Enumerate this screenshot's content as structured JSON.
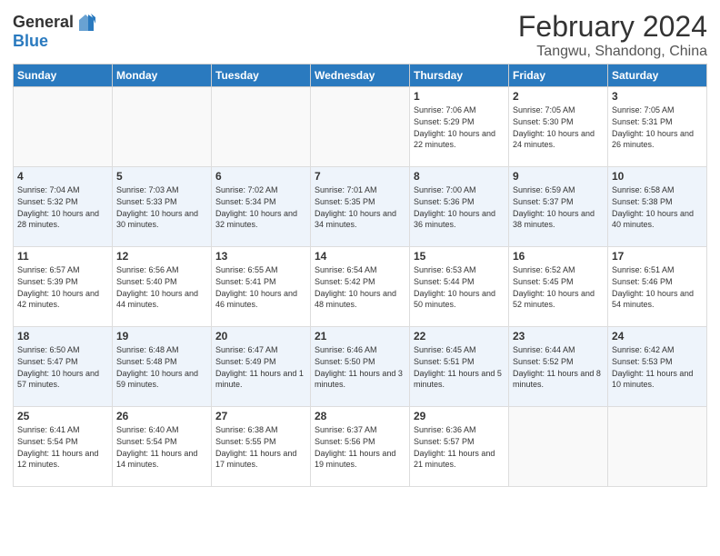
{
  "header": {
    "logo_general": "General",
    "logo_blue": "Blue",
    "month_title": "February 2024",
    "location": "Tangwu, Shandong, China"
  },
  "days_of_week": [
    "Sunday",
    "Monday",
    "Tuesday",
    "Wednesday",
    "Thursday",
    "Friday",
    "Saturday"
  ],
  "weeks": [
    [
      {
        "day": "",
        "info": ""
      },
      {
        "day": "",
        "info": ""
      },
      {
        "day": "",
        "info": ""
      },
      {
        "day": "",
        "info": ""
      },
      {
        "day": "1",
        "info": "Sunrise: 7:06 AM\nSunset: 5:29 PM\nDaylight: 10 hours and 22 minutes."
      },
      {
        "day": "2",
        "info": "Sunrise: 7:05 AM\nSunset: 5:30 PM\nDaylight: 10 hours and 24 minutes."
      },
      {
        "day": "3",
        "info": "Sunrise: 7:05 AM\nSunset: 5:31 PM\nDaylight: 10 hours and 26 minutes."
      }
    ],
    [
      {
        "day": "4",
        "info": "Sunrise: 7:04 AM\nSunset: 5:32 PM\nDaylight: 10 hours and 28 minutes."
      },
      {
        "day": "5",
        "info": "Sunrise: 7:03 AM\nSunset: 5:33 PM\nDaylight: 10 hours and 30 minutes."
      },
      {
        "day": "6",
        "info": "Sunrise: 7:02 AM\nSunset: 5:34 PM\nDaylight: 10 hours and 32 minutes."
      },
      {
        "day": "7",
        "info": "Sunrise: 7:01 AM\nSunset: 5:35 PM\nDaylight: 10 hours and 34 minutes."
      },
      {
        "day": "8",
        "info": "Sunrise: 7:00 AM\nSunset: 5:36 PM\nDaylight: 10 hours and 36 minutes."
      },
      {
        "day": "9",
        "info": "Sunrise: 6:59 AM\nSunset: 5:37 PM\nDaylight: 10 hours and 38 minutes."
      },
      {
        "day": "10",
        "info": "Sunrise: 6:58 AM\nSunset: 5:38 PM\nDaylight: 10 hours and 40 minutes."
      }
    ],
    [
      {
        "day": "11",
        "info": "Sunrise: 6:57 AM\nSunset: 5:39 PM\nDaylight: 10 hours and 42 minutes."
      },
      {
        "day": "12",
        "info": "Sunrise: 6:56 AM\nSunset: 5:40 PM\nDaylight: 10 hours and 44 minutes."
      },
      {
        "day": "13",
        "info": "Sunrise: 6:55 AM\nSunset: 5:41 PM\nDaylight: 10 hours and 46 minutes."
      },
      {
        "day": "14",
        "info": "Sunrise: 6:54 AM\nSunset: 5:42 PM\nDaylight: 10 hours and 48 minutes."
      },
      {
        "day": "15",
        "info": "Sunrise: 6:53 AM\nSunset: 5:44 PM\nDaylight: 10 hours and 50 minutes."
      },
      {
        "day": "16",
        "info": "Sunrise: 6:52 AM\nSunset: 5:45 PM\nDaylight: 10 hours and 52 minutes."
      },
      {
        "day": "17",
        "info": "Sunrise: 6:51 AM\nSunset: 5:46 PM\nDaylight: 10 hours and 54 minutes."
      }
    ],
    [
      {
        "day": "18",
        "info": "Sunrise: 6:50 AM\nSunset: 5:47 PM\nDaylight: 10 hours and 57 minutes."
      },
      {
        "day": "19",
        "info": "Sunrise: 6:48 AM\nSunset: 5:48 PM\nDaylight: 10 hours and 59 minutes."
      },
      {
        "day": "20",
        "info": "Sunrise: 6:47 AM\nSunset: 5:49 PM\nDaylight: 11 hours and 1 minute."
      },
      {
        "day": "21",
        "info": "Sunrise: 6:46 AM\nSunset: 5:50 PM\nDaylight: 11 hours and 3 minutes."
      },
      {
        "day": "22",
        "info": "Sunrise: 6:45 AM\nSunset: 5:51 PM\nDaylight: 11 hours and 5 minutes."
      },
      {
        "day": "23",
        "info": "Sunrise: 6:44 AM\nSunset: 5:52 PM\nDaylight: 11 hours and 8 minutes."
      },
      {
        "day": "24",
        "info": "Sunrise: 6:42 AM\nSunset: 5:53 PM\nDaylight: 11 hours and 10 minutes."
      }
    ],
    [
      {
        "day": "25",
        "info": "Sunrise: 6:41 AM\nSunset: 5:54 PM\nDaylight: 11 hours and 12 minutes."
      },
      {
        "day": "26",
        "info": "Sunrise: 6:40 AM\nSunset: 5:54 PM\nDaylight: 11 hours and 14 minutes."
      },
      {
        "day": "27",
        "info": "Sunrise: 6:38 AM\nSunset: 5:55 PM\nDaylight: 11 hours and 17 minutes."
      },
      {
        "day": "28",
        "info": "Sunrise: 6:37 AM\nSunset: 5:56 PM\nDaylight: 11 hours and 19 minutes."
      },
      {
        "day": "29",
        "info": "Sunrise: 6:36 AM\nSunset: 5:57 PM\nDaylight: 11 hours and 21 minutes."
      },
      {
        "day": "",
        "info": ""
      },
      {
        "day": "",
        "info": ""
      }
    ]
  ]
}
